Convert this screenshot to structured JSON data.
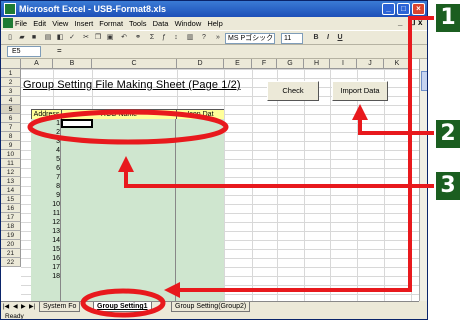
{
  "window": {
    "title": "Microsoft Excel - USB-Format8.xls"
  },
  "menu": [
    "File",
    "Edit",
    "View",
    "Insert",
    "Format",
    "Tools",
    "Data",
    "Window",
    "Help"
  ],
  "doc_controls": {
    "min": "_",
    "restore": "❐",
    "close": "x"
  },
  "toolbar": {
    "font": "MS Pゴシック",
    "size": "11",
    "bold": "B",
    "italic": "I",
    "underline": "U"
  },
  "formula_bar": {
    "name_box": "E5",
    "fx": "="
  },
  "columns": [
    "A",
    "B",
    "C",
    "D",
    "E",
    "F",
    "G",
    "H",
    "I",
    "J",
    "K"
  ],
  "rows": [
    "1",
    "2",
    "3",
    "4",
    "5",
    "6",
    "7",
    "8",
    "9",
    "10",
    "11",
    "12",
    "13",
    "14",
    "15",
    "16",
    "17",
    "18",
    "19",
    "20",
    "21",
    "22"
  ],
  "sheet": {
    "title": "Group Setting File Making Sheet (Page 1/2)",
    "check_button": "Check",
    "import_button": "Import Data",
    "table_headers": {
      "address": "Address",
      "rcg_name": "RCG Name",
      "icon_data": "Icon Dat"
    },
    "addresses": [
      "1",
      "2",
      "3",
      "4",
      "5",
      "6",
      "7",
      "8",
      "9",
      "10",
      "11",
      "12",
      "13",
      "14",
      "15",
      "16",
      "17",
      "18"
    ]
  },
  "tabs": {
    "prev": "System Fo",
    "active": "Group Setting1",
    "next": "Group Setting(Group2)"
  },
  "status": "Ready",
  "callouts": [
    "1",
    "2",
    "3"
  ],
  "colors": {
    "accent_red": "#e8191d",
    "callout_green": "#1b5e20",
    "header_yellow": "#ffff99",
    "table_green": "#cfe6cf"
  }
}
